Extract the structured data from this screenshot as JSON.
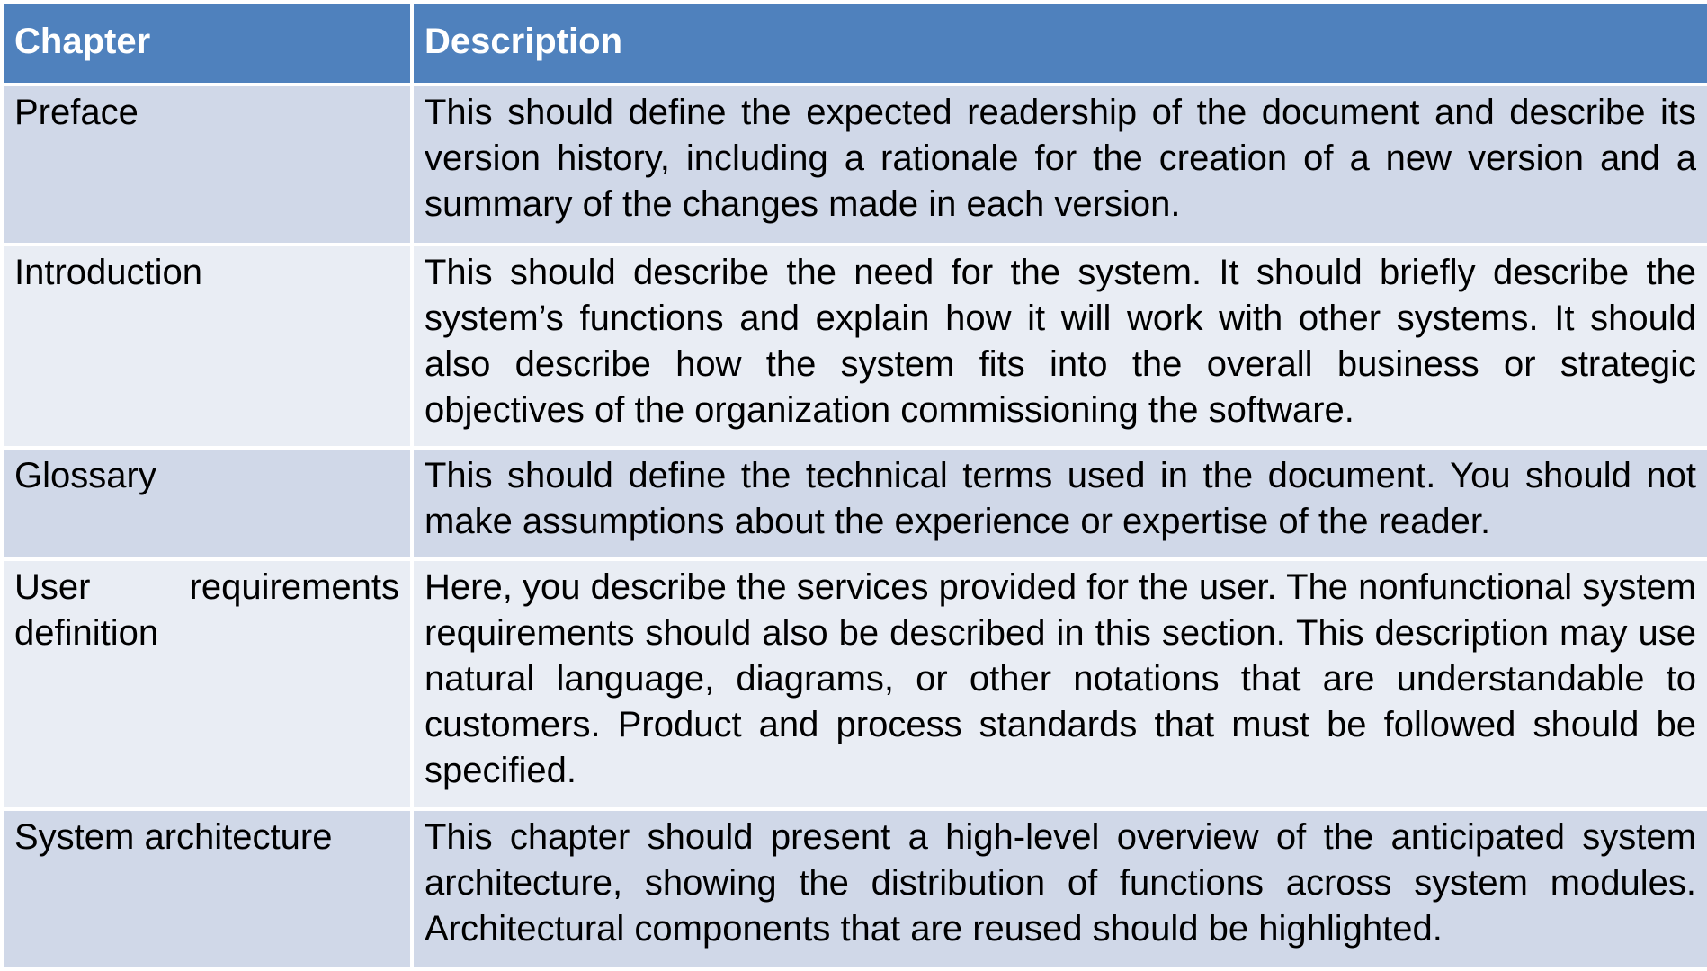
{
  "table": {
    "headers": {
      "chapter": "Chapter",
      "description": "Description"
    },
    "rows": [
      {
        "chapter": "Preface",
        "description": "This should define the expected readership of the document and describe its version history, including a rationale for the creation of a new version and a summary of the changes made in each version."
      },
      {
        "chapter": "Introduction",
        "description": "This should describe the need for the system. It should briefly describe the system’s functions and explain how it will work with other systems. It should also describe how the system fits into the overall business or strategic objectives of the organization commissioning the software."
      },
      {
        "chapter": "Glossary",
        "description": "This should define the technical terms used in the document. You should not make assumptions about the experience or expertise of the reader."
      },
      {
        "chapter": "User requirements definition",
        "chapter_word1": "User",
        "chapter_word2": "requirements",
        "chapter_word3": "definition",
        "description": "Here, you describe the services provided for the user. The nonfunctional system requirements should also be described in this section. This description may use natural language, diagrams, or other notations that are understandable to customers. Product and process standards that must be followed should be specified."
      },
      {
        "chapter": "System architecture",
        "description": "This chapter should present a high-level overview of the anticipated system architecture, showing the distribution of functions across system modules. Architectural components that are reused should be highlighted."
      }
    ]
  },
  "colors": {
    "header_bg": "#4f81bd",
    "row_dark": "#d0d8e8",
    "row_light": "#e9edf4",
    "border": "#ffffff"
  }
}
